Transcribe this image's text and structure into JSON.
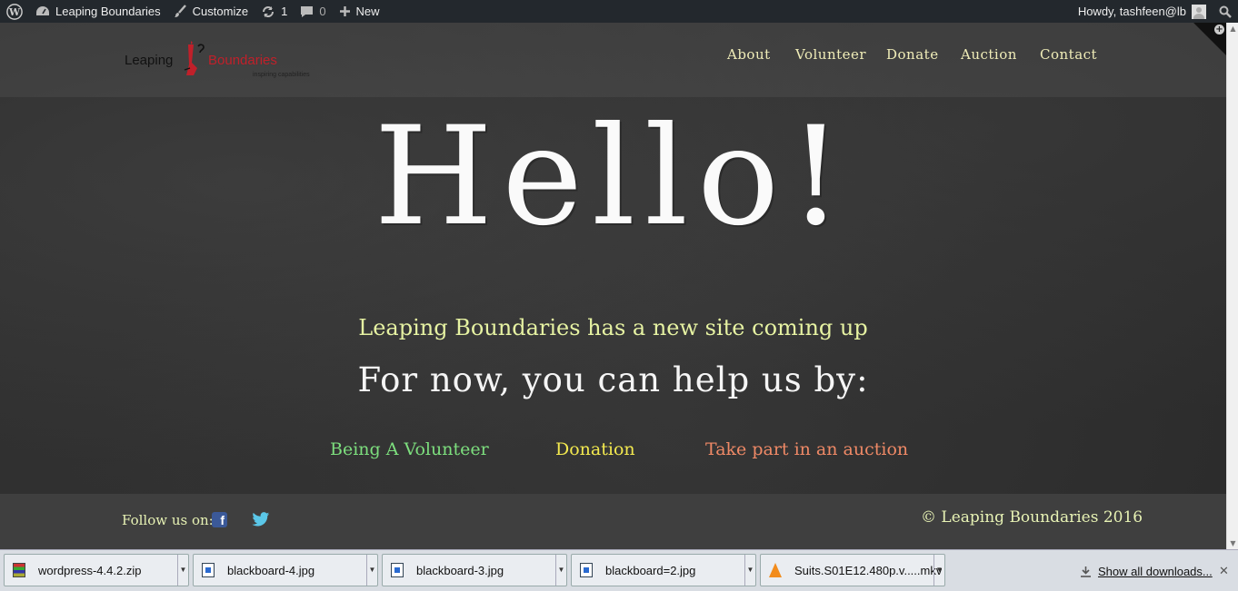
{
  "admin_bar": {
    "site_name": "Leaping Boundaries",
    "customize": "Customize",
    "updates_count": "1",
    "comments_count": "0",
    "new_label": "New",
    "greeting": "Howdy, tashfeen@lb"
  },
  "site": {
    "logo": {
      "word1": "Leaping",
      "word2": "Boundaries",
      "tagline": "inspiring capabilities"
    },
    "nav": [
      "About",
      "Volunteer",
      "Donate",
      "Auction",
      "Contact"
    ],
    "hero_title": "Hello!",
    "subtitle": "Leaping Boundaries has a new site coming up",
    "help_heading": "For now, you can help us by:",
    "options": [
      {
        "label": "Being A Volunteer",
        "color": "#7ddf7e"
      },
      {
        "label": "Donation",
        "color": "#f3e94f"
      },
      {
        "label": "Take part in an auction",
        "color": "#ef8966"
      }
    ],
    "footer": {
      "follow": "Follow us on:",
      "social": [
        "facebook-icon",
        "twitter-icon"
      ],
      "copyright": "© Leaping Boundaries 2016"
    }
  },
  "downloads": {
    "items": [
      {
        "name": "wordpress-4.4.2.zip",
        "icon": "zip-icon"
      },
      {
        "name": "blackboard-4.jpg",
        "icon": "image-icon"
      },
      {
        "name": "blackboard-3.jpg",
        "icon": "image-icon"
      },
      {
        "name": "blackboard=2.jpg",
        "icon": "image-icon"
      },
      {
        "name": "Suits.S01E12.480p.v.....mkv",
        "icon": "vlc-icon"
      }
    ],
    "show_all": "Show all downloads..."
  }
}
